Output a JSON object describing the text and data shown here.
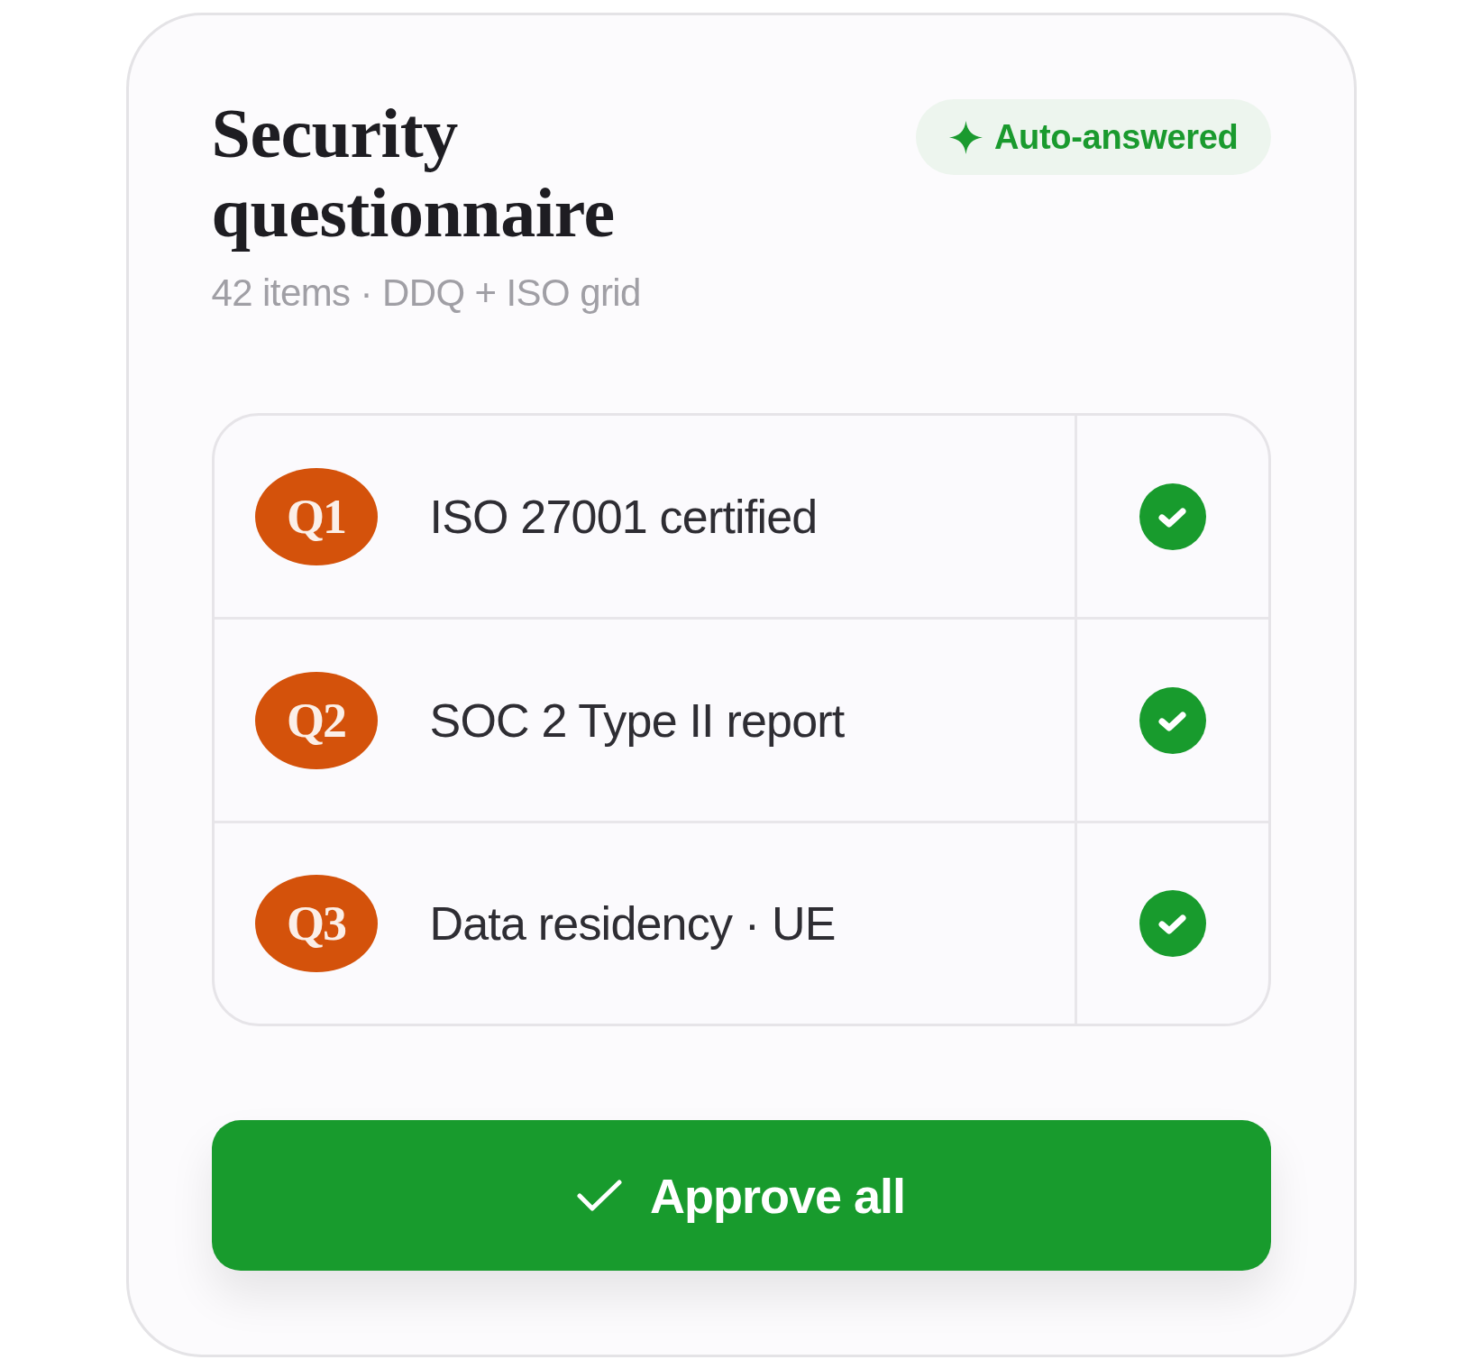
{
  "card": {
    "title": "Security questionnaire",
    "subtitle": "42 items · DDQ + ISO grid",
    "badge": {
      "label": "Auto-answered"
    }
  },
  "questions": [
    {
      "tag": "Q1",
      "text": "ISO 27001 certified",
      "checked": true
    },
    {
      "tag": "Q2",
      "text": "SOC 2 Type II report",
      "checked": true
    },
    {
      "tag": "Q3",
      "text": "Data residency · UE",
      "checked": true
    }
  ],
  "approve_button": {
    "label": "Approve all"
  }
}
